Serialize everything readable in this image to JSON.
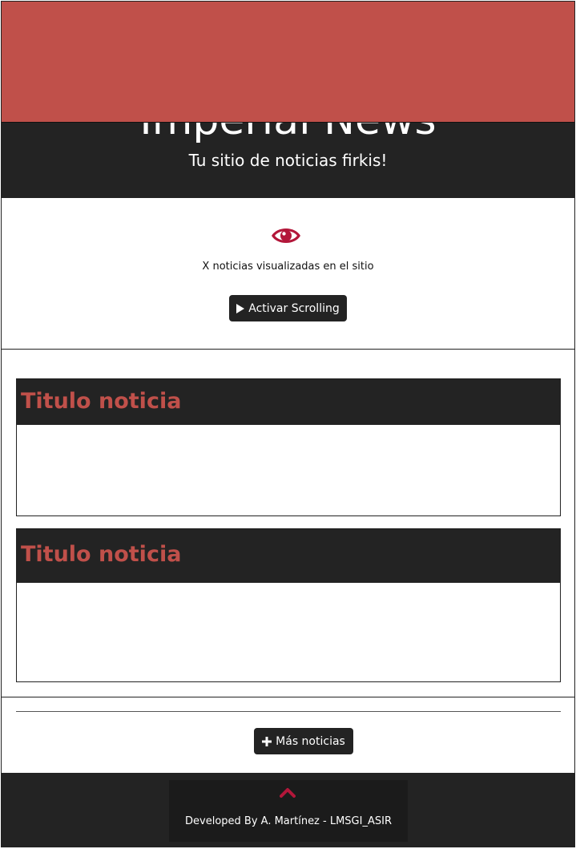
{
  "header": {
    "title": "Imperial News",
    "subtitle": "Tu sitio de noticias firkis!"
  },
  "stats": {
    "icon": "eye-icon",
    "visits_text": "X noticias visualizadas en el sitio",
    "scroll_button": {
      "icon": "play-icon",
      "label": "Activar Scrolling"
    }
  },
  "news": [
    {
      "title": "Titulo noticia"
    },
    {
      "title": "Titulo noticia"
    }
  ],
  "more_button": {
    "icon": "plus-icon",
    "label": "Más noticias"
  },
  "footer": {
    "icon": "chevron-up-icon",
    "text": "Developed By A. Martínez - LMSGI_ASIR"
  },
  "colors": {
    "dark": "#232323",
    "accent_red": "#c0504a",
    "icon_red": "#b3173a",
    "overlay": "#c0504a"
  }
}
